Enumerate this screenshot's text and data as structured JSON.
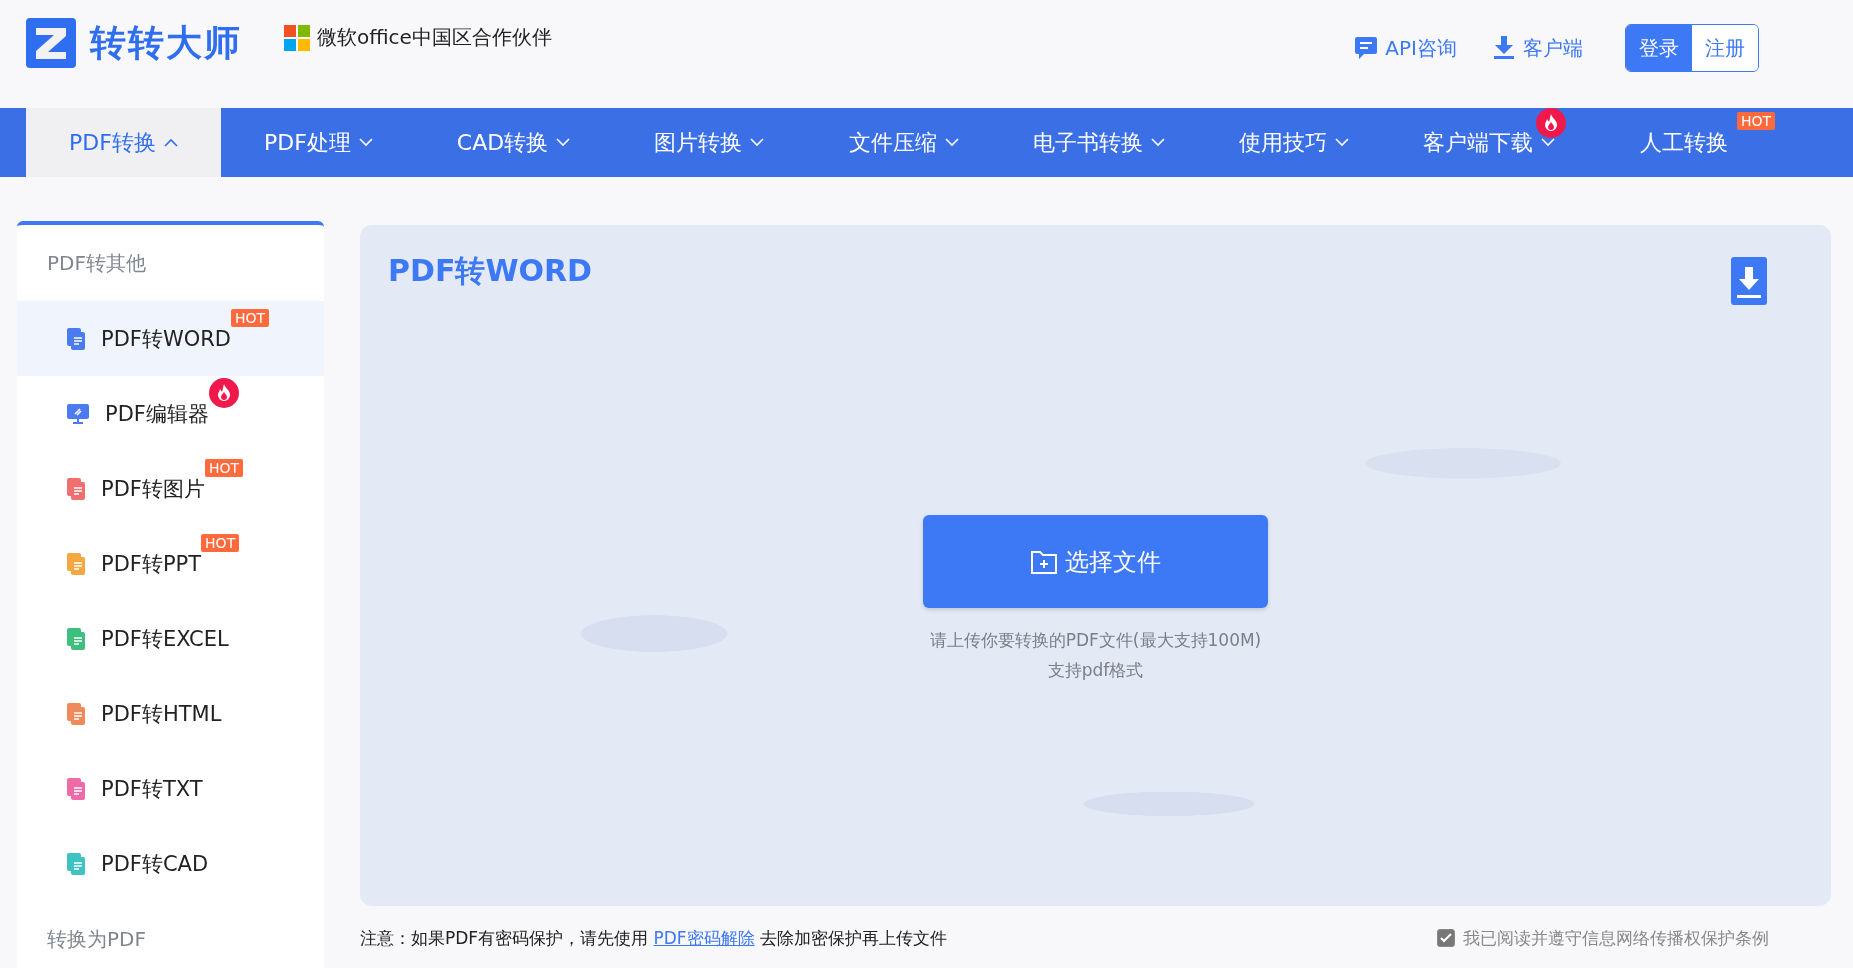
{
  "header": {
    "brand": "转转大师",
    "partner": "微软office中国区合作伙伴",
    "links": [
      {
        "kind": "chat",
        "label": "API咨询"
      },
      {
        "kind": "download",
        "label": "客户端"
      }
    ],
    "auth": [
      {
        "label": "登录",
        "selected": true
      },
      {
        "label": "注册",
        "selected": false
      }
    ]
  },
  "nav": [
    {
      "label": "PDF转换",
      "selected": true,
      "dropdown": true
    },
    {
      "label": "PDF处理",
      "selected": false,
      "dropdown": true
    },
    {
      "label": "CAD转换",
      "selected": false,
      "dropdown": true
    },
    {
      "label": "图片转换",
      "selected": false,
      "dropdown": true
    },
    {
      "label": "文件压缩",
      "selected": false,
      "dropdown": true
    },
    {
      "label": "电子书转换",
      "selected": false,
      "dropdown": true
    },
    {
      "label": "使用技巧",
      "selected": false,
      "dropdown": true
    },
    {
      "label": "客户端下载",
      "selected": false,
      "dropdown": true,
      "badge": {
        "kind": "fire"
      }
    },
    {
      "label": "人工转换",
      "selected": false,
      "dropdown": false,
      "badge": {
        "kind": "hot",
        "text": "HOT"
      }
    }
  ],
  "sidebar": {
    "sections": [
      {
        "title": "PDF转其他",
        "items": [
          {
            "label": "PDF转WORD",
            "selected": true,
            "kind": "doc",
            "color": "#4a7cf0",
            "badge": {
              "kind": "hot",
              "text": "HOT"
            }
          },
          {
            "label": "PDF编辑器",
            "selected": false,
            "kind": "monitor",
            "color": "#4a7cf0",
            "badge": {
              "kind": "fire"
            }
          },
          {
            "label": "PDF转图片",
            "selected": false,
            "kind": "doc",
            "color": "#f07070",
            "badge": {
              "kind": "hot",
              "text": "HOT"
            }
          },
          {
            "label": "PDF转PPT",
            "selected": false,
            "kind": "doc",
            "color": "#f5a742",
            "badge": {
              "kind": "hot",
              "text": "HOT"
            }
          },
          {
            "label": "PDF转EXCEL",
            "selected": false,
            "kind": "doc",
            "color": "#3fbf7f"
          },
          {
            "label": "PDF转HTML",
            "selected": false,
            "kind": "doc",
            "color": "#f08a5a"
          },
          {
            "label": "PDF转TXT",
            "selected": false,
            "kind": "doc",
            "color": "#f06aa8"
          },
          {
            "label": "PDF转CAD",
            "selected": false,
            "kind": "doc",
            "color": "#3ec2c2"
          }
        ]
      },
      {
        "title": "转换为PDF"
      }
    ]
  },
  "main": {
    "title": "PDF转WORD",
    "upload_button": "选择文件",
    "hints": [
      "请上传你要转换的PDF文件(最大支持100M)",
      "支持pdf格式"
    ]
  },
  "footer": {
    "notice_before": "注意：如果PDF有密码保护，请先使用",
    "notice_link": "PDF密码解除",
    "notice_after": "去除加密保护再上传文件",
    "agreement": {
      "label": "我已阅读并遵守信息网络传播权保护条例",
      "checked": true
    }
  }
}
